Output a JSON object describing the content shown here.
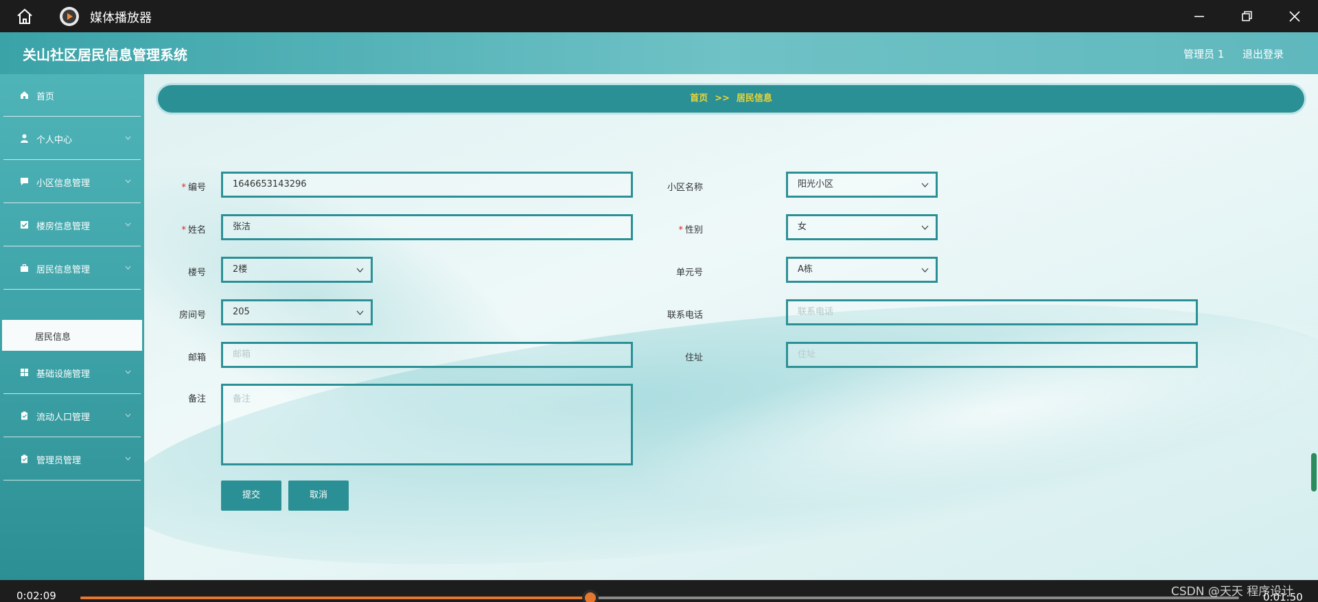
{
  "window": {
    "title": "媒体播放器"
  },
  "app": {
    "title": "关山社区居民信息管理系统",
    "admin": "管理员 1",
    "logout": "退出登录"
  },
  "sidebar": {
    "items": [
      {
        "label": "首页",
        "icon": "home-icon"
      },
      {
        "label": "个人中心",
        "icon": "user-icon"
      },
      {
        "label": "小区信息管理",
        "icon": "chat-icon"
      },
      {
        "label": "楼房信息管理",
        "icon": "check-square-icon"
      },
      {
        "label": "居民信息管理",
        "icon": "briefcase-icon"
      },
      {
        "label": "基础设施管理",
        "icon": "grid-icon"
      },
      {
        "label": "流动人口管理",
        "icon": "clipboard-icon"
      },
      {
        "label": "管理员管理",
        "icon": "clipboard-icon"
      }
    ],
    "active_sub": "居民信息"
  },
  "breadcrumb": {
    "home": "首页",
    "sep": ">>",
    "current": "居民信息"
  },
  "form": {
    "number": {
      "label": "编号",
      "value": "1646653143296"
    },
    "name": {
      "label": "姓名",
      "value": "张洁"
    },
    "building": {
      "label": "楼号",
      "value": "2楼"
    },
    "room": {
      "label": "房间号",
      "value": "205"
    },
    "email": {
      "label": "邮箱",
      "placeholder": "邮箱"
    },
    "note": {
      "label": "备注",
      "placeholder": "备注"
    },
    "community": {
      "label": "小区名称",
      "value": "阳光小区"
    },
    "gender": {
      "label": "性别",
      "value": "女"
    },
    "unit": {
      "label": "单元号",
      "value": "A栋"
    },
    "phone": {
      "label": "联系电话",
      "placeholder": "联系电话"
    },
    "address": {
      "label": "住址",
      "placeholder": "住址"
    },
    "submit": "提交",
    "cancel": "取消"
  },
  "player": {
    "elapsed": "0:02:09",
    "remaining": "0:01:50",
    "progress_fraction": 0.44,
    "watermark": "CSDN @天天 程序设计",
    "accent": "#e6772e"
  },
  "colors": {
    "primary": "#2b9095",
    "breadcrumb_text": "#f0d531",
    "required": "#e02020"
  }
}
